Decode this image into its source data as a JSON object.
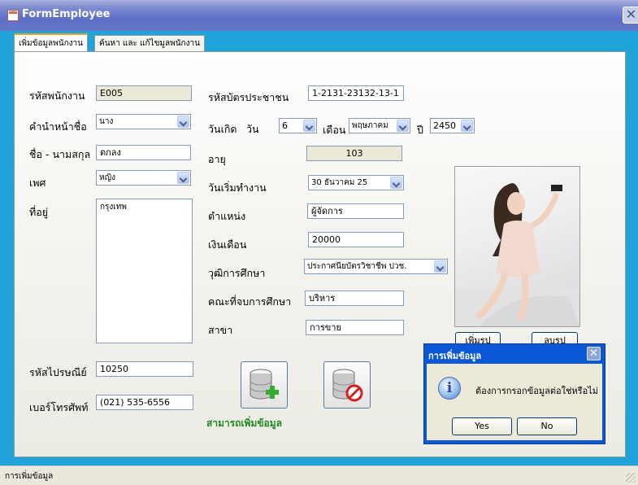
{
  "window": {
    "title": "FormEmployee",
    "close_glyph": "✕"
  },
  "tabs": [
    {
      "label": "เพิ่มข้อมูลพนักงาน",
      "active": true
    },
    {
      "label": "ค้นหา และ แก้ไขมูลพนักงาน",
      "active": false
    }
  ],
  "form": {
    "employee_id": {
      "label": "รหัสพนักงาน",
      "value": "E005"
    },
    "prefix": {
      "label": "คำนำหน้าชื่อ",
      "value": "นาง"
    },
    "full_name": {
      "label": "ชื่อ - นามสกุล",
      "value": "ตกลง"
    },
    "gender": {
      "label": "เพศ",
      "value": "หญิง"
    },
    "address": {
      "label": "ที่อยู่",
      "value": "กรุงเทพ"
    },
    "postal_code": {
      "label": "รหัสไปรษณีย์",
      "value": "10250"
    },
    "phone": {
      "label": "เบอร์โทรศัพท์",
      "value": "(021) 535-6556"
    },
    "national_id": {
      "label": "รหัสบัตรประชาชน",
      "value": "1-2131-23132-13-1"
    },
    "birthdate": {
      "label": "วันเกิด",
      "day_label": "วัน",
      "day": "6",
      "month_label": "เดือน",
      "month": "พฤษภาคม",
      "year_label": "ปี",
      "year": "2450"
    },
    "age": {
      "label": "อายุ",
      "value": "103"
    },
    "start_date": {
      "label": "วันเริ่มทำงาน",
      "value": "30  ธันวาคม    25"
    },
    "position": {
      "label": "ตำแหน่ง",
      "value": "ผู้จัดการ"
    },
    "salary": {
      "label": "เงินเดือน",
      "value": "20000"
    },
    "education": {
      "label": "วุฒิการศึกษา",
      "value": "ประกาศนียบัตรวิชาชีพ ปวช."
    },
    "faculty": {
      "label": "คณะที่จบการศึกษา",
      "value": "บริหาร"
    },
    "major": {
      "label": "สาขา",
      "value": "การขาย"
    }
  },
  "photo_buttons": {
    "add": "เพิ่มรูป",
    "delete": "ลบรูป"
  },
  "actions": {
    "add_icon": "database-add-icon",
    "cancel_icon": "database-cancel-icon",
    "status_message": "สามารถเพิ่มข้อมูล"
  },
  "dialog": {
    "title": "การเพิ่มข้อมูล",
    "message": "ต้องการกรอกข้อมูลต่อใช่หรือไม่",
    "yes": "Yes",
    "no": "No",
    "close_glyph": "✕"
  },
  "statusbar": {
    "text": "การเพิ่มข้อมูล"
  }
}
